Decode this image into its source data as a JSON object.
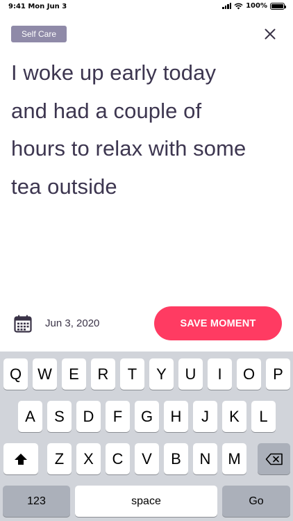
{
  "status_bar": {
    "time": "9:41 Mon Jun 3",
    "battery": "100%"
  },
  "header": {
    "category": "Self Care"
  },
  "moment": {
    "line1": "I woke up early today",
    "line2": "and had a couple of",
    "line3": "hours to relax with some",
    "line4": "tea outside"
  },
  "footer": {
    "date": "Jun 3, 2020",
    "save_label": "SAVE MOMENT"
  },
  "keyboard": {
    "row1": [
      "Q",
      "W",
      "E",
      "R",
      "T",
      "Y",
      "U",
      "I",
      "O",
      "P"
    ],
    "row2": [
      "A",
      "S",
      "D",
      "F",
      "G",
      "H",
      "J",
      "K",
      "L"
    ],
    "row3": [
      "Z",
      "X",
      "C",
      "V",
      "B",
      "N",
      "M"
    ],
    "numbers_label": "123",
    "space_label": "space",
    "go_label": "Go"
  },
  "colors": {
    "accent": "#ff3b62",
    "tag": "#8f8aa8",
    "text": "#3d3650",
    "keyboard_bg": "#d1d4da"
  }
}
